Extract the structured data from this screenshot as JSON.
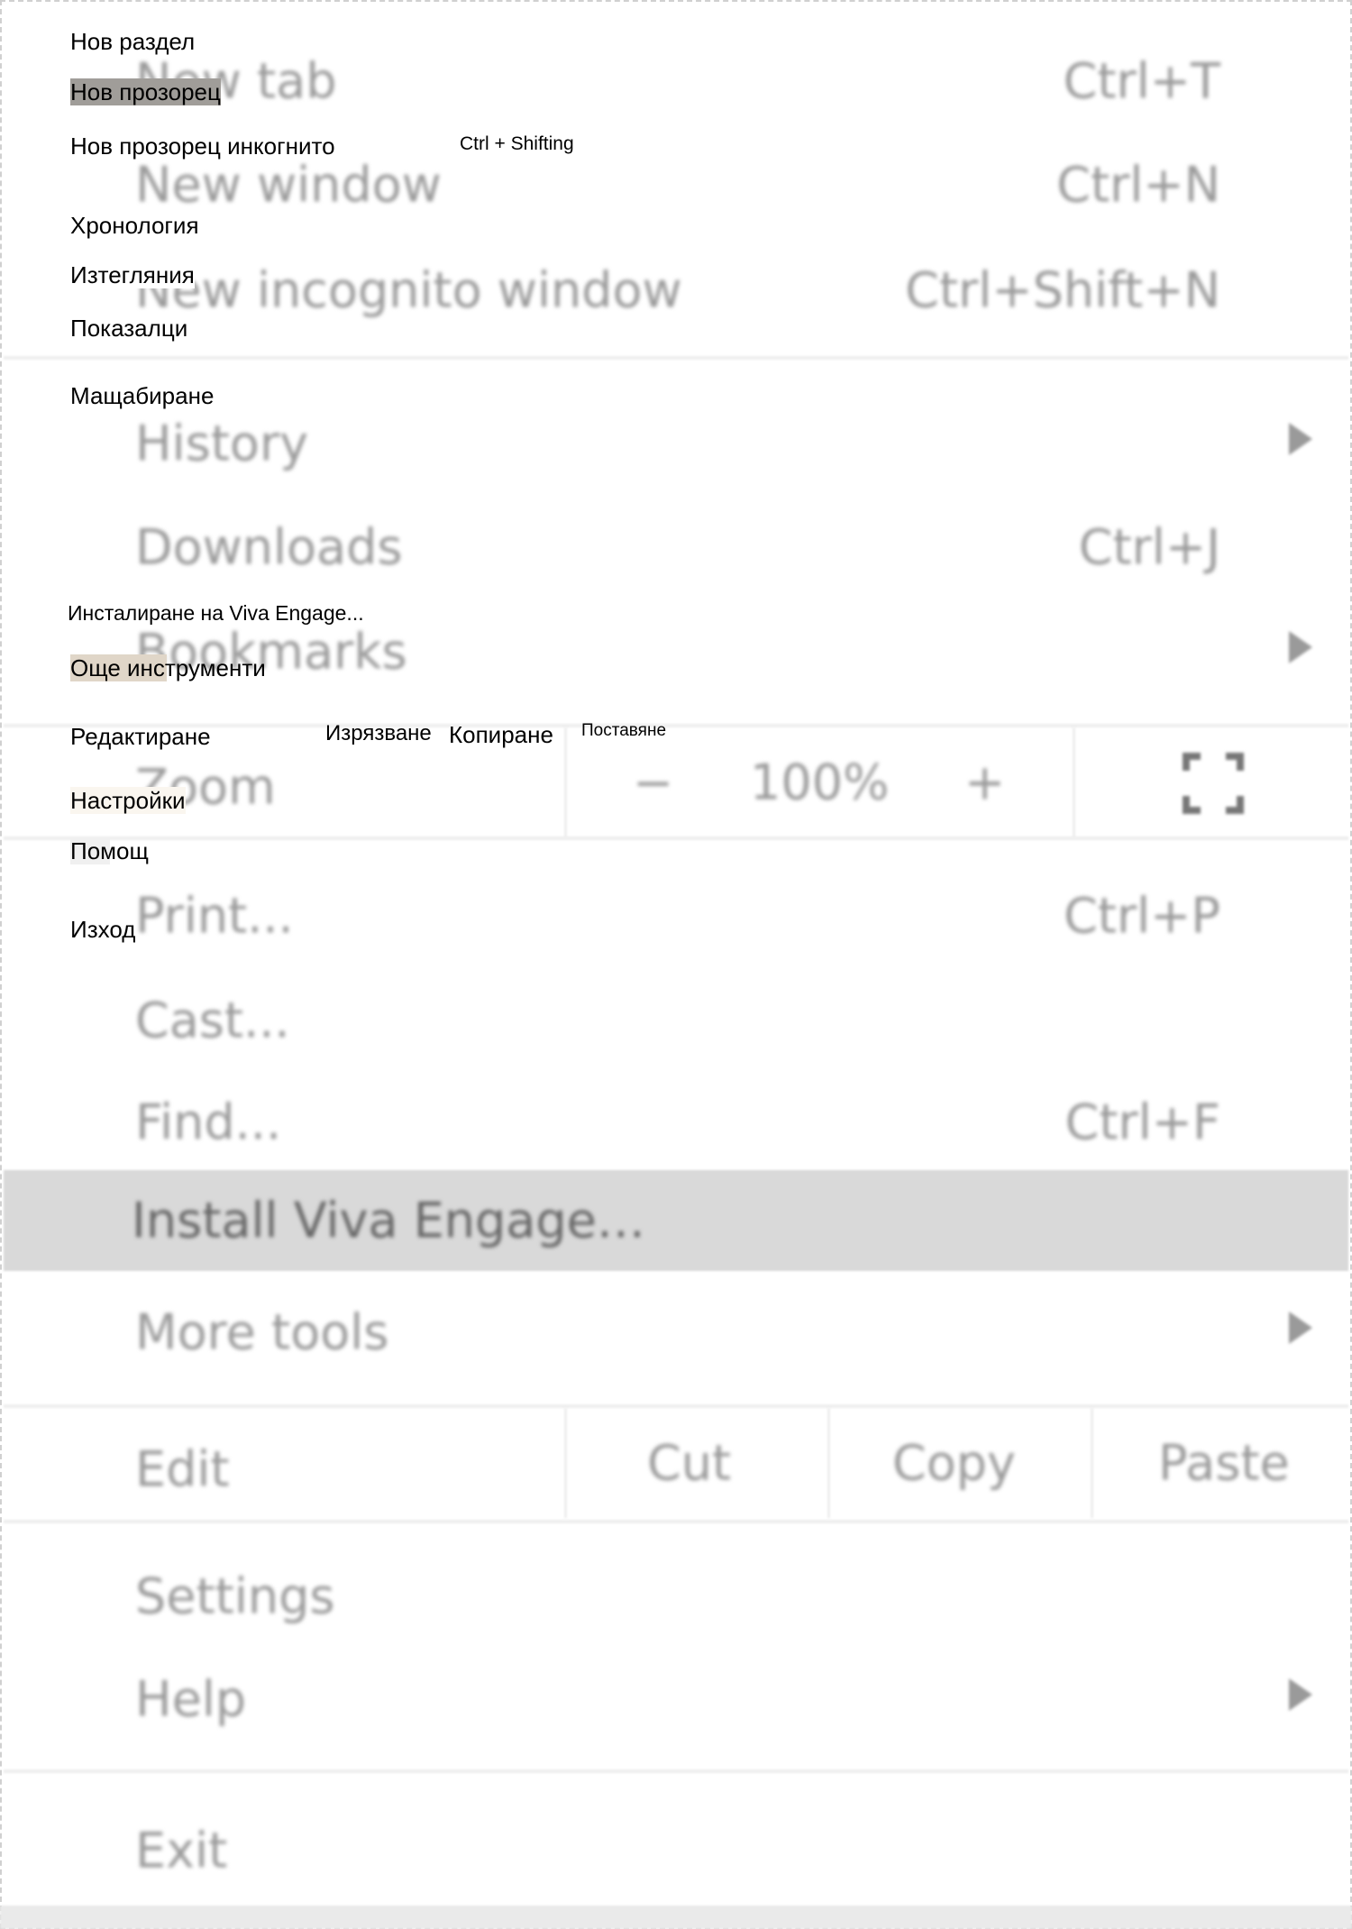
{
  "menu": {
    "new_tab": {
      "label": "New tab",
      "shortcut": "Ctrl+T"
    },
    "new_window": {
      "label": "New window",
      "shortcut": "Ctrl+N"
    },
    "new_incognito": {
      "label": "New incognito window",
      "shortcut": "Ctrl+Shift+N"
    },
    "history": {
      "label": "History"
    },
    "downloads": {
      "label": "Downloads",
      "shortcut": "Ctrl+J"
    },
    "bookmarks": {
      "label": "Bookmarks"
    },
    "zoom": {
      "label": "Zoom",
      "minus": "−",
      "value": "100%",
      "plus": "+"
    },
    "print": {
      "label": "Print...",
      "shortcut": "Ctrl+P"
    },
    "cast": {
      "label": "Cast..."
    },
    "find": {
      "label": "Find...",
      "shortcut": "Ctrl+F"
    },
    "install": {
      "label": "Install Viva Engage…"
    },
    "more_tools": {
      "label": "More tools"
    },
    "edit": {
      "label": "Edit",
      "cut": "Cut",
      "copy": "Copy",
      "paste": "Paste"
    },
    "settings": {
      "label": "Settings"
    },
    "help": {
      "label": "Help"
    },
    "exit": {
      "label": "Exit"
    }
  },
  "translations": {
    "new_tab": "Нов раздел",
    "new_window": "Нов прозорец",
    "new_incognito": "Нов прозорец инкогнито",
    "incognito_shortcut": "Ctrl + Shifting",
    "history": "Хронология",
    "downloads": "Изтегляния",
    "bookmarks": "Показалци",
    "zoom": "Мащабиране",
    "install": "Инсталиране на Viva Engage...",
    "more_tools": "Още инструменти",
    "edit": "Редактиране",
    "cut": "Изрязване",
    "copy": "Копиране",
    "paste": "Поставяне",
    "settings": "Настройки",
    "help": "Помощ",
    "exit": "Изход"
  },
  "colors": {
    "highlight": "#d9d9d9",
    "text_blur": "#9a9a9a",
    "new_window_tag": "#a09d99",
    "more_tools_tag": "#e0d6c8"
  }
}
